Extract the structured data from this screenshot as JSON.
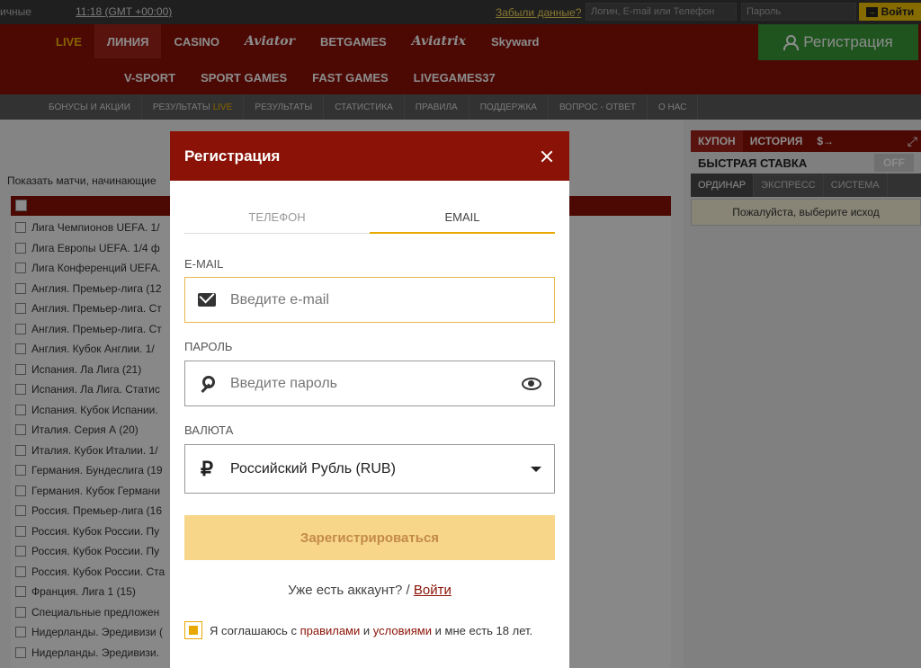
{
  "topbar": {
    "odds_format": "ичные",
    "time": "11:18 (GMT +00:00)",
    "forgot": "Забыли данные?",
    "login_placeholder": "Логин, E-mail или Телефон",
    "password_placeholder": "Пароль",
    "enter_label": "Войти"
  },
  "nav": {
    "row1": [
      "LIVE",
      "ЛИНИЯ",
      "CASINO",
      "Aviator",
      "BETGAMES",
      "Aviatrix",
      "Skyward"
    ],
    "row2": [
      "V-SPORT",
      "SPORT GAMES",
      "FAST GAMES",
      "LIVEGAMES37"
    ],
    "register_label": "Регистрация"
  },
  "subnav": {
    "items": [
      "БОНУСЫ И АКЦИИ",
      "РЕЗУЛЬТАТЫ",
      "РЕЗУЛЬТАТЫ",
      "СТАТИСТИКА",
      "ПРАВИЛА",
      "ПОДДЕРЖКА",
      "ВОПРОС - ОТВЕТ",
      "О НАС"
    ],
    "live_word": "LIVE"
  },
  "content": {
    "show_matches": "Показать матчи, начинающие",
    "leagues": [
      "Лига Чемпионов UEFA. 1/",
      "Лига Европы UEFA. 1/4 ф",
      "Лига Конференций UEFA.",
      "Англия. Премьер-лига (12",
      "Англия. Премьер-лига. Ст",
      "Англия. Премьер-лига. Ст",
      "Англия. Кубок Англии. 1/",
      "Испания. Ла Лига (21)",
      "Испания. Ла Лига. Статис",
      "Испания. Кубок Испании.",
      "Италия. Серия А (20)",
      "Италия. Кубок Италии. 1/",
      "Германия. Бундеслига (19",
      "Германия. Кубок Германи",
      "Россия. Премьер-лига (16",
      "Россия. Кубок России. Пу",
      "Россия. Кубок России. Пу",
      "Россия. Кубок России. Ста",
      "Франция. Лига 1 (15)",
      "Специальные предложен",
      "Нидерланды. Эредивизи (",
      "Нидерланды. Эредивизи."
    ]
  },
  "coupon": {
    "tabs": [
      "КУПОН",
      "ИСТОРИЯ",
      "$→"
    ],
    "quick_bet": "БЫСТРАЯ СТАВКА",
    "quick_state": "OFF",
    "types": [
      "ОРДИНАР",
      "ЭКСПРЕСС",
      "СИСТЕМА"
    ],
    "hint": "Пожалуйста, выберите исход"
  },
  "modal": {
    "title": "Регистрация",
    "tabs": [
      "ТЕЛЕФОН",
      "EMAIL"
    ],
    "email_label": "E-MAIL",
    "email_placeholder": "Введите e-mail",
    "password_label": "ПАРОЛЬ",
    "password_placeholder": "Введите пароль",
    "currency_label": "ВАЛЮТА",
    "currency_value": "Российский Рубль (RUB)",
    "currency_symbol": "₽",
    "submit_label": "Зарегистрироваться",
    "have_account": "Уже есть аккаунт? /",
    "login_link": "Войти",
    "agree_prefix": "Я соглашаюсь с",
    "agree_rules": "правилами",
    "agree_and": "и",
    "agree_terms": "условиями",
    "agree_suffix": "и мне есть 18 лет."
  }
}
